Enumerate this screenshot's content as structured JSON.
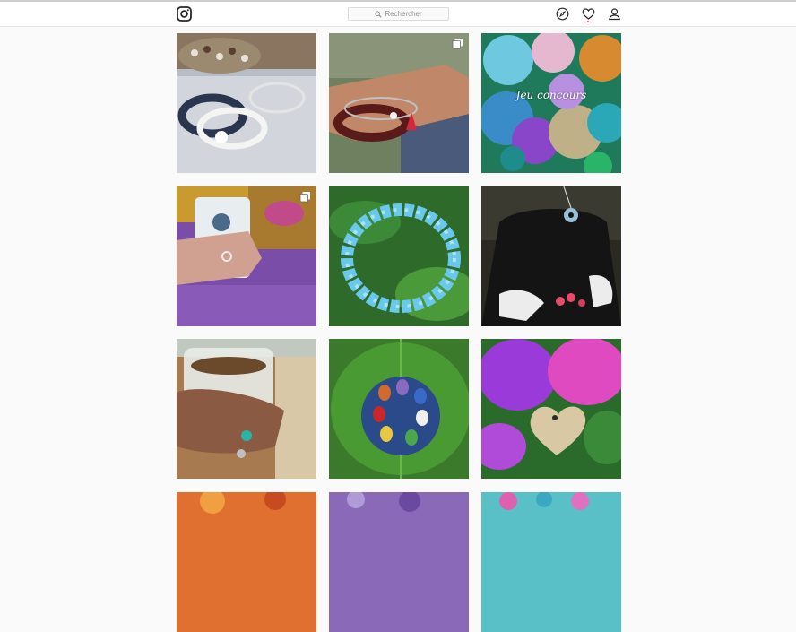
{
  "nav": {
    "logo_icon": "instagram-camera-icon",
    "search_placeholder": "Rechercher",
    "search_icon": "search-icon",
    "icons": [
      "compass-icon",
      "heart-icon",
      "user-icon"
    ],
    "activity_dot_color": "#ed4956"
  },
  "posts": [
    {
      "subject": "white bead bracelets with lava stones",
      "multi": false
    },
    {
      "subject": "wrist with red bead bracelet and tassel",
      "multi": true
    },
    {
      "subject": "colorful crystal spheres",
      "multi": false,
      "caption": "Jeu concours"
    },
    {
      "subject": "hand holding mug on purple cushion",
      "multi": true
    },
    {
      "subject": "blue bead bracelet on leaves",
      "multi": false
    },
    {
      "subject": "pendant on black top with flowers",
      "multi": false
    },
    {
      "subject": "hand holding glass of coffee with ring",
      "multi": false
    },
    {
      "subject": "chakra stone pendant on green leaf",
      "multi": false
    },
    {
      "subject": "wooden heart pendant on purple flowers",
      "multi": false
    },
    {
      "subject": "orange flowers",
      "multi": false
    },
    {
      "subject": "purple beads",
      "multi": false
    },
    {
      "subject": "pink and turquoise beads",
      "multi": false
    }
  ]
}
